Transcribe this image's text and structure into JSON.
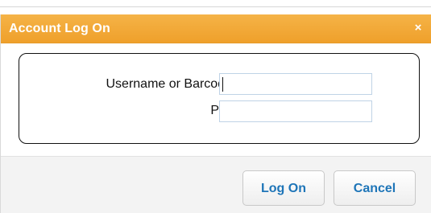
{
  "dialog": {
    "title": "Account Log On",
    "close_symbol": "×"
  },
  "form": {
    "username_label": "Username or Barcode",
    "username_value": "",
    "pin_label": "PIN",
    "pin_value": ""
  },
  "buttons": {
    "logon_label": "Log On",
    "cancel_label": "Cancel"
  },
  "icons": {
    "close": "close-icon"
  }
}
